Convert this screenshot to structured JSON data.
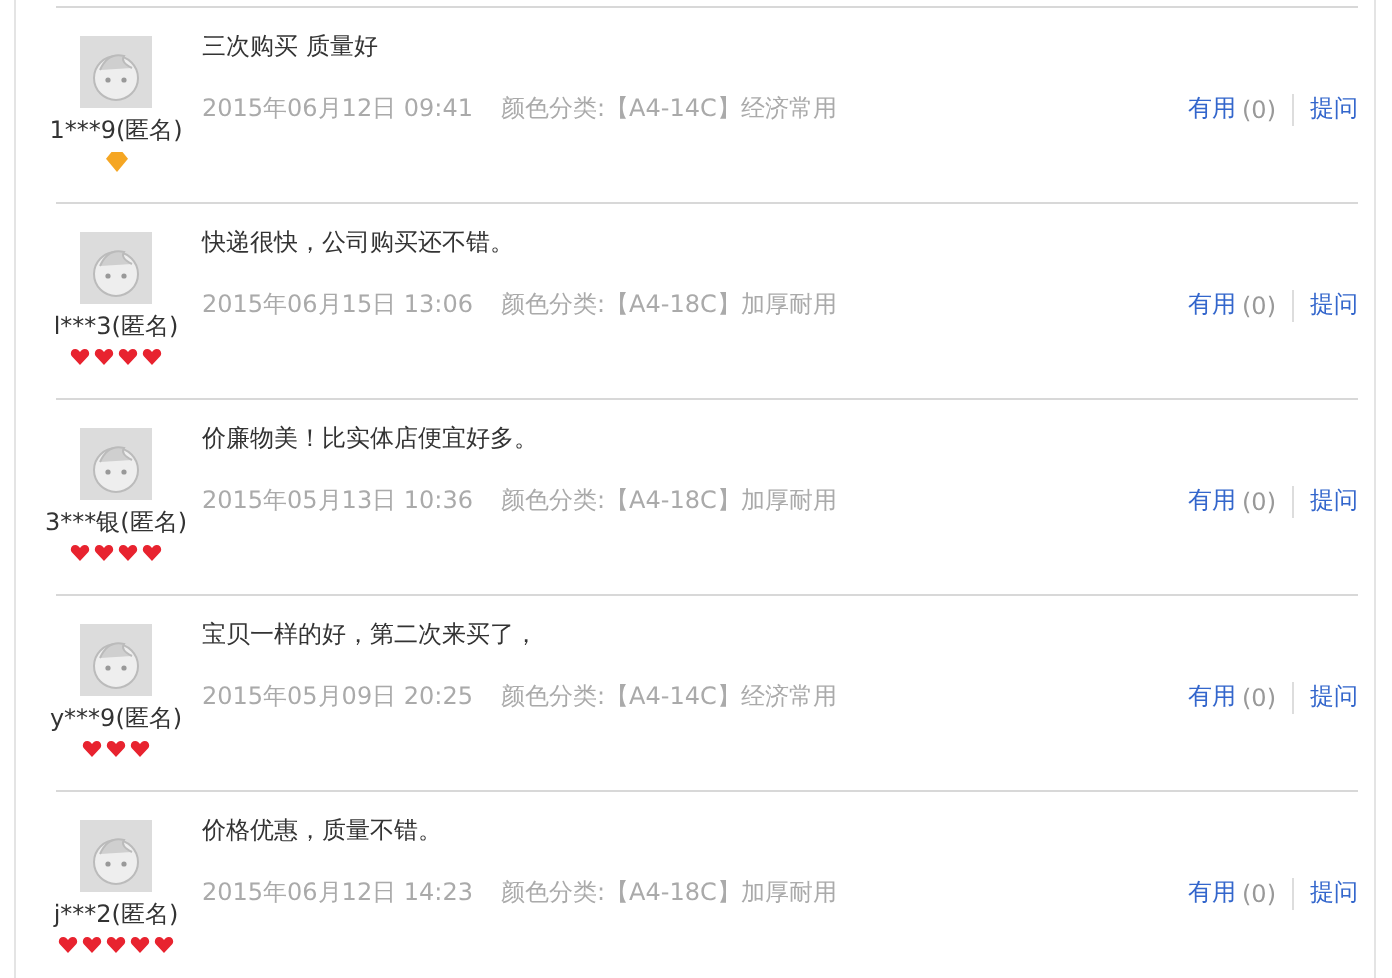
{
  "reviews": [
    {
      "user": "1***9(匿名)",
      "rank_icons": [
        {
          "kind": "diamond"
        }
      ],
      "text": "三次购买 质量好",
      "date": "2015年06月12日 09:41",
      "sku_label": "颜色分类:",
      "sku": "【A4-14C】经济常用",
      "useful": "有用",
      "useful_count": "(0)",
      "ask": "提问"
    },
    {
      "user": "l***3(匿名)",
      "rank_icons": [
        {
          "kind": "heart"
        },
        {
          "kind": "heart"
        },
        {
          "kind": "heart"
        },
        {
          "kind": "heart"
        }
      ],
      "text": "快递很快，公司购买还不错。",
      "date": "2015年06月15日 13:06",
      "sku_label": "颜色分类:",
      "sku": "【A4-18C】加厚耐用",
      "useful": "有用",
      "useful_count": "(0)",
      "ask": "提问"
    },
    {
      "user": "3***银(匿名)",
      "rank_icons": [
        {
          "kind": "heart"
        },
        {
          "kind": "heart"
        },
        {
          "kind": "heart"
        },
        {
          "kind": "heart"
        }
      ],
      "text": "价廉物美！比实体店便宜好多。",
      "date": "2015年05月13日 10:36",
      "sku_label": "颜色分类:",
      "sku": "【A4-18C】加厚耐用",
      "useful": "有用",
      "useful_count": "(0)",
      "ask": "提问"
    },
    {
      "user": "y***9(匿名)",
      "rank_icons": [
        {
          "kind": "heart"
        },
        {
          "kind": "heart"
        },
        {
          "kind": "heart"
        }
      ],
      "text": "宝贝一样的好，第二次来买了，",
      "date": "2015年05月09日 20:25",
      "sku_label": "颜色分类:",
      "sku": "【A4-14C】经济常用",
      "useful": "有用",
      "useful_count": "(0)",
      "ask": "提问"
    },
    {
      "user": "j***2(匿名)",
      "rank_icons": [
        {
          "kind": "heart"
        },
        {
          "kind": "heart"
        },
        {
          "kind": "heart"
        },
        {
          "kind": "heart"
        },
        {
          "kind": "heart"
        }
      ],
      "text": "价格优惠，质量不错。",
      "date": "2015年06月12日 14:23",
      "sku_label": "颜色分类:",
      "sku": "【A4-18C】加厚耐用",
      "useful": "有用",
      "useful_count": "(0)",
      "ask": "提问"
    }
  ]
}
